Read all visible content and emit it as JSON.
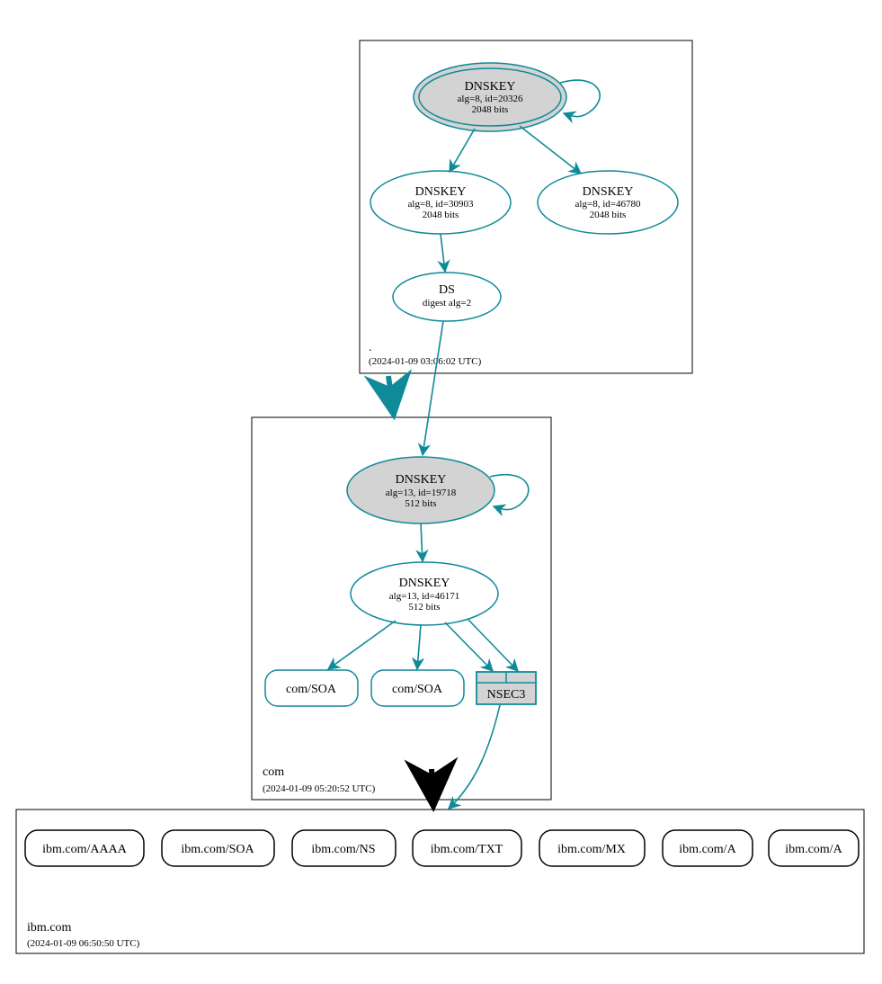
{
  "colors": {
    "teal": "#0E8A99",
    "greyfill": "#d3d3d3"
  },
  "zones": {
    "root": {
      "label": ".",
      "timestamp": "(2024-01-09 03:06:02 UTC)"
    },
    "com": {
      "label": "com",
      "timestamp": "(2024-01-09 05:20:52 UTC)"
    },
    "ibm": {
      "label": "ibm.com",
      "timestamp": "(2024-01-09 06:50:50 UTC)"
    }
  },
  "nodes": {
    "root_ksk": {
      "title": "DNSKEY",
      "line2": "alg=8, id=20326",
      "line3": "2048 bits"
    },
    "root_zsk1": {
      "title": "DNSKEY",
      "line2": "alg=8, id=30903",
      "line3": "2048 bits"
    },
    "root_zsk2": {
      "title": "DNSKEY",
      "line2": "alg=8, id=46780",
      "line3": "2048 bits"
    },
    "root_ds": {
      "title": "DS",
      "line2": "digest alg=2"
    },
    "com_ksk": {
      "title": "DNSKEY",
      "line2": "alg=13, id=19718",
      "line3": "512 bits"
    },
    "com_zsk": {
      "title": "DNSKEY",
      "line2": "alg=13, id=46171",
      "line3": "512 bits"
    },
    "com_soa1": {
      "label": "com/SOA"
    },
    "com_soa2": {
      "label": "com/SOA"
    },
    "nsec3": {
      "label": "NSEC3"
    },
    "ibm_aaaa": {
      "label": "ibm.com/AAAA"
    },
    "ibm_soa": {
      "label": "ibm.com/SOA"
    },
    "ibm_ns": {
      "label": "ibm.com/NS"
    },
    "ibm_txt": {
      "label": "ibm.com/TXT"
    },
    "ibm_mx": {
      "label": "ibm.com/MX"
    },
    "ibm_a1": {
      "label": "ibm.com/A"
    },
    "ibm_a2": {
      "label": "ibm.com/A"
    }
  }
}
